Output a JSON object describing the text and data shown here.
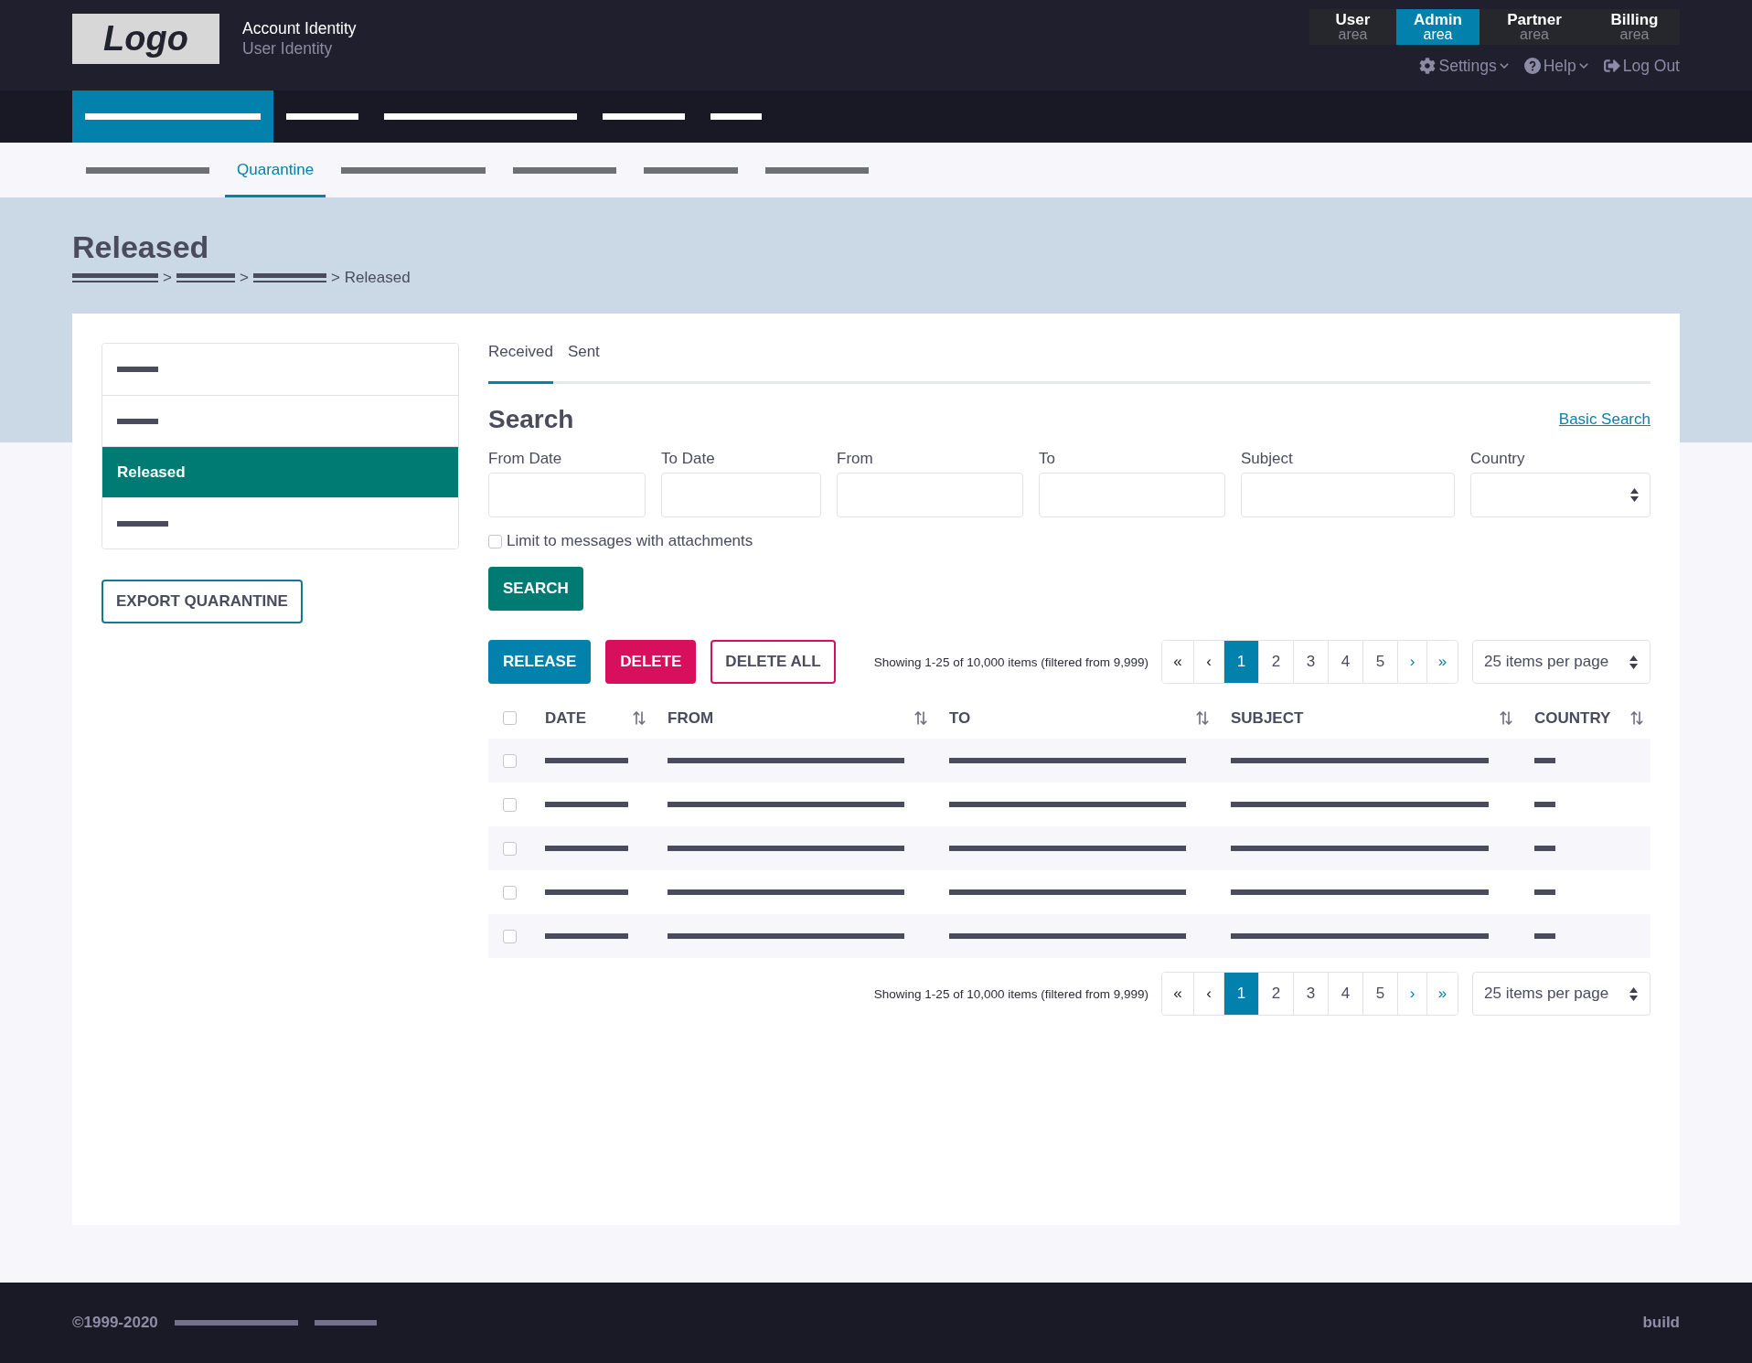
{
  "header": {
    "logo": "Logo",
    "account": "Account Identity",
    "user": "User Identity",
    "areas": [
      {
        "title": "User",
        "subtitle": "area",
        "selected": false
      },
      {
        "title": "Admin",
        "subtitle": "area",
        "selected": true
      },
      {
        "title": "Partner",
        "subtitle": "area",
        "selected": false
      },
      {
        "title": "Billing",
        "subtitle": "area",
        "selected": false
      }
    ],
    "links": [
      {
        "label": "Settings",
        "kind": "settings",
        "dropdown": true
      },
      {
        "label": "Help",
        "kind": "help",
        "dropdown": true
      },
      {
        "label": "Log Out",
        "kind": "logout",
        "dropdown": false
      }
    ]
  },
  "main_nav": {
    "items": [
      {
        "selected": true
      },
      {
        "selected": false
      },
      {
        "selected": false
      },
      {
        "selected": false
      },
      {
        "selected": false
      }
    ]
  },
  "sub_nav": {
    "items": [
      {
        "kind": "redacted",
        "selected": false
      },
      {
        "kind": "label",
        "label": "Quarantine",
        "selected": true
      },
      {
        "kind": "redacted",
        "selected": false
      },
      {
        "kind": "redacted",
        "selected": false
      },
      {
        "kind": "redacted",
        "selected": false
      },
      {
        "kind": "redacted",
        "selected": false
      }
    ]
  },
  "page": {
    "title": "Released",
    "breadcrumb": [
      {
        "kind": "redacted"
      },
      {
        "kind": "redacted",
        "separator": ">"
      },
      {
        "kind": "redacted",
        "separator": ">"
      },
      {
        "kind": "label",
        "label": "Released",
        "separator": ">"
      }
    ]
  },
  "sidebar": {
    "items": [
      {
        "kind": "redacted",
        "selected": false
      },
      {
        "kind": "redacted",
        "selected": false
      },
      {
        "kind": "label",
        "label": "Released",
        "selected": true
      },
      {
        "kind": "redacted",
        "selected": false
      }
    ],
    "export_button": "EXPORT QUARANTINE"
  },
  "tabs": [
    {
      "label": "Received",
      "selected": true
    },
    {
      "label": "Sent",
      "selected": false
    }
  ],
  "search": {
    "title": "Search",
    "basic_link": "Basic Search",
    "fields": [
      {
        "label": "From Date",
        "kind": "input"
      },
      {
        "label": "To Date",
        "kind": "input"
      },
      {
        "label": "From",
        "kind": "input"
      },
      {
        "label": "To",
        "kind": "input"
      },
      {
        "label": "Subject",
        "kind": "input"
      },
      {
        "label": "Country",
        "kind": "select"
      }
    ],
    "attachments": {
      "label": "Limit to messages with attachments",
      "checked": false
    },
    "button": "SEARCH"
  },
  "actions": [
    {
      "label": "RELEASE",
      "kind": "primary"
    },
    {
      "label": "DELETE",
      "kind": "danger"
    },
    {
      "label": "DELETE ALL",
      "kind": "outline"
    }
  ],
  "top_pager": {
    "summary": "Showing 1-25 of 10,000 items (filtered from 9,999)",
    "controls": [
      {
        "label": "«",
        "kind": "first",
        "selected": false
      },
      {
        "label": "‹",
        "kind": "prev",
        "selected": false
      },
      {
        "label": "1",
        "kind": "page",
        "selected": true
      },
      {
        "label": "2",
        "kind": "page",
        "selected": false
      },
      {
        "label": "3",
        "kind": "page",
        "selected": false
      },
      {
        "label": "4",
        "kind": "page",
        "selected": false
      },
      {
        "label": "5",
        "kind": "page",
        "selected": false
      },
      {
        "label": "›",
        "kind": "next",
        "selected": false
      },
      {
        "label": "»",
        "kind": "last",
        "selected": false
      }
    ],
    "page_size": "25 items per page"
  },
  "table": {
    "select_all": {
      "checked": false
    },
    "columns": [
      {
        "label": "DATE"
      },
      {
        "label": "FROM"
      },
      {
        "label": "TO"
      },
      {
        "label": "SUBJECT"
      },
      {
        "label": "COUNTRY"
      }
    ],
    "rows": [
      {
        "checked": false
      },
      {
        "checked": false
      },
      {
        "checked": false
      },
      {
        "checked": false
      },
      {
        "checked": false
      }
    ]
  },
  "bottom_pager": {
    "summary": "Showing 1-25 of 10,000 items (filtered from 9,999)",
    "controls": [
      {
        "label": "«",
        "kind": "first",
        "selected": false
      },
      {
        "label": "‹",
        "kind": "prev",
        "selected": false
      },
      {
        "label": "1",
        "kind": "page",
        "selected": true
      },
      {
        "label": "2",
        "kind": "page",
        "selected": false
      },
      {
        "label": "3",
        "kind": "page",
        "selected": false
      },
      {
        "label": "4",
        "kind": "page",
        "selected": false
      },
      {
        "label": "5",
        "kind": "page",
        "selected": false
      },
      {
        "label": "›",
        "kind": "next",
        "selected": false
      },
      {
        "label": "»",
        "kind": "last",
        "selected": false
      }
    ],
    "page_size": "25 items per page"
  },
  "footer": {
    "copyright": "©1999-2020",
    "links": [
      {
        "kind": "redacted"
      },
      {
        "kind": "redacted"
      }
    ],
    "build": "build"
  }
}
